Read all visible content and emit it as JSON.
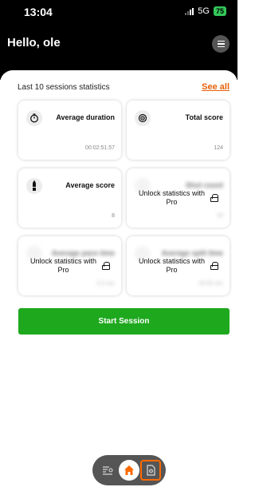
{
  "status_bar": {
    "time": "13:04",
    "network": "5G",
    "battery": "75"
  },
  "header": {
    "greeting": "Hello, ole",
    "menu_icon": "hamburger-menu-icon"
  },
  "stats": {
    "title": "Last 10 sessions statistics",
    "see_all": "See all"
  },
  "cards": [
    {
      "label": "Average duration",
      "value": "00:02:51.57",
      "icon": "timer-icon",
      "locked": false
    },
    {
      "label": "Total score",
      "value": "124",
      "icon": "target-icon",
      "locked": false
    },
    {
      "label": "Average score",
      "value": "8",
      "icon": "bullet-icon",
      "locked": false
    },
    {
      "label": "Shot count",
      "value": "30",
      "icon": "shot-count-icon",
      "locked": true
    },
    {
      "label": "Average pace time",
      "value": "0.5 sec",
      "icon": "pace-icon",
      "locked": true
    },
    {
      "label": "Average split time",
      "value": "00:00 sec",
      "icon": "split-icon",
      "locked": true
    }
  ],
  "lock_text": "Unlock statistics with Pro",
  "start_button": "Start Session",
  "accent_colors": {
    "see_all": "#e8600a",
    "start_button": "#1ea81e",
    "nav_home": "#ff6a00",
    "nav_highlight": "#ff6a00"
  }
}
